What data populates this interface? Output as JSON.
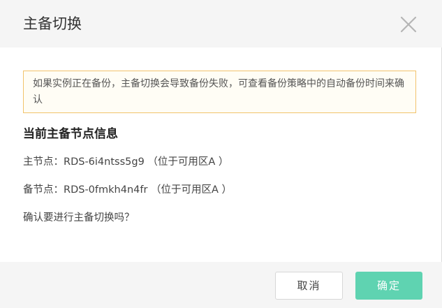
{
  "dialog": {
    "title": "主备切换",
    "close_icon": "close-icon"
  },
  "notice": {
    "text": "如果实例正在备份，主备切换会导致备份失败，可查看备份策略中的自动备份时间来确认"
  },
  "info": {
    "section_title": "当前主备节点信息",
    "primary_label": "主节点：",
    "primary_value": "RDS-6i4ntss5g9 （位于可用区A ）",
    "standby_label": "备节点：",
    "standby_value": "RDS-0fmkh4n4fr （位于可用区A ）",
    "confirm_question": "确认要进行主备切换吗？"
  },
  "footer": {
    "cancel_label": "取消",
    "ok_label": "确定"
  },
  "colors": {
    "accent": "#5fd3b1",
    "notice_border": "#f2c36b",
    "header_bg": "#f5f5f5"
  }
}
